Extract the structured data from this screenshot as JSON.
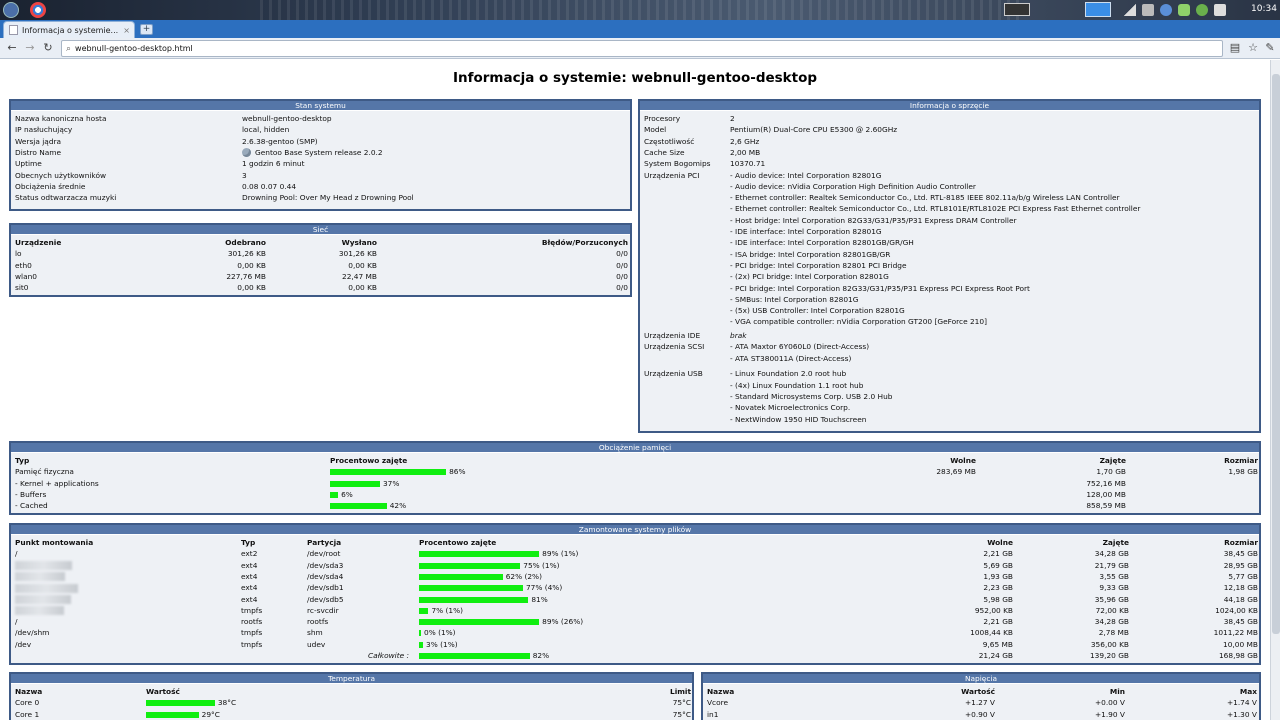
{
  "desktop": {
    "clock": "10:34"
  },
  "browser": {
    "tab_title": "Informacja o systemie...",
    "new_tab": "+",
    "url": "webnull-gentoo-desktop.html"
  },
  "page_title": "Informacja o systemie: webnull-gentoo-desktop",
  "system": {
    "title": "Stan systemu",
    "rows": [
      {
        "label": "Nazwa kanoniczna hosta",
        "value": "webnull-gentoo-desktop"
      },
      {
        "label": "IP nasłuchujący",
        "value": "local, hidden"
      },
      {
        "label": "Wersja jądra",
        "value": "2.6.38-gentoo (SMP)"
      },
      {
        "label": "Distro Name",
        "value": "Gentoo Base System release 2.0.2"
      },
      {
        "label": "Uptime",
        "value": "1 godzin 6 minut"
      },
      {
        "label": "Obecnych użytkowników",
        "value": "3"
      },
      {
        "label": "Obciążenia średnie",
        "value": "0.08 0.07 0.44"
      },
      {
        "label": "Status odtwarzacza muzyki",
        "value": "Drowning Pool: Over My Head z Drowning Pool"
      }
    ]
  },
  "network": {
    "title": "Sieć",
    "headers": [
      "Urządzenie",
      "Odebrano",
      "Wysłano",
      "Błędów/Porzuconych"
    ],
    "rows": [
      [
        "lo",
        "301,26 KB",
        "301,26 KB",
        "0/0"
      ],
      [
        "eth0",
        "0,00 KB",
        "0,00 KB",
        "0/0"
      ],
      [
        "wlan0",
        "227,76 MB",
        "22,47 MB",
        "0/0"
      ],
      [
        "sit0",
        "0,00 KB",
        "0,00 KB",
        "0/0"
      ]
    ]
  },
  "hardware": {
    "title": "Informacja o sprzęcie",
    "rows": [
      {
        "label": "Procesory",
        "value": "2"
      },
      {
        "label": "Model",
        "value": "Pentium(R) Dual-Core CPU E5300 @ 2.60GHz"
      },
      {
        "label": "Częstotliwość",
        "value": "2,6 GHz"
      },
      {
        "label": "Cache Size",
        "value": "2,00 MB"
      },
      {
        "label": "System Bogomips",
        "value": "10370.71"
      }
    ],
    "pci_label": "Urządzenia PCI",
    "pci": [
      "- Audio device: Intel Corporation 82801G",
      "- Audio device: nVidia Corporation High Definition Audio Controller",
      "- Ethernet controller: Realtek Semiconductor Co., Ltd. RTL-8185 IEEE 802.11a/b/g Wireless LAN Controller",
      "- Ethernet controller: Realtek Semiconductor Co., Ltd. RTL8101E/RTL8102E PCI Express Fast Ethernet controller",
      "- Host bridge: Intel Corporation 82G33/G31/P35/P31 Express DRAM Controller",
      "- IDE interface: Intel Corporation 82801G",
      "- IDE interface: Intel Corporation 82801GB/GR/GH",
      "- ISA bridge: Intel Corporation 82801GB/GR",
      "- PCI bridge: Intel Corporation 82801 PCI Bridge",
      "- (2x) PCI bridge: Intel Corporation 82801G",
      "- PCI bridge: Intel Corporation 82G33/G31/P35/P31 Express PCI Express Root Port",
      "- SMBus: Intel Corporation 82801G",
      "- (5x) USB Controller: Intel Corporation 82801G",
      "- VGA compatible controller: nVidia Corporation GT200 [GeForce 210]"
    ],
    "ide_label": "Urządzenia IDE",
    "ide_value": "brak",
    "scsi_label": "Urządzenia SCSI",
    "scsi": [
      "- ATA Maxtor 6Y060L0 (Direct-Access)",
      "- ATA ST380011A (Direct-Access)"
    ],
    "usb_label": "Urządzenia USB",
    "usb": [
      "- Linux Foundation 2.0 root hub",
      "- (4x) Linux Foundation 1.1 root hub",
      "- Standard Microsystems Corp. USB 2.0 Hub",
      "- Novatek Microelectronics Corp.",
      "- NextWindow 1950 HID Touchscreen"
    ]
  },
  "memory": {
    "title": "Obciążenie pamięci",
    "headers": [
      "Typ",
      "Procentowo zajęte",
      "Wolne",
      "Zajęte",
      "Rozmiar"
    ],
    "rows": [
      {
        "type": "Pamięć fizyczna",
        "pct": 86,
        "pct_text": "86%",
        "free": "283,69 MB",
        "used": "1,70 GB",
        "size": "1,98 GB"
      },
      {
        "type": "- Kernel + applications",
        "pct": 37,
        "pct_text": "37%",
        "free": "",
        "used": "752,16 MB",
        "size": ""
      },
      {
        "type": "- Buffers",
        "pct": 6,
        "pct_text": "6%",
        "free": "",
        "used": "128,00 MB",
        "size": ""
      },
      {
        "type": "- Cached",
        "pct": 42,
        "pct_text": "42%",
        "free": "",
        "used": "858,59 MB",
        "size": ""
      }
    ]
  },
  "filesystems": {
    "title": "Zamontowane systemy plików",
    "headers": [
      "Punkt montowania",
      "Typ",
      "Partycja",
      "Procentowo zajęte",
      "Wolne",
      "Zajęte",
      "Rozmiar"
    ],
    "rows": [
      {
        "mount": "/",
        "type": "ext2",
        "part": "/dev/root",
        "pct": 89,
        "pct_text": "89% (1%)",
        "free": "2,21 GB",
        "used": "34,28 GB",
        "size": "38,45 GB"
      },
      {
        "mount": "",
        "type": "ext4",
        "part": "/dev/sda3",
        "pct": 75,
        "pct_text": "75% (1%)",
        "free": "5,69 GB",
        "used": "21,79 GB",
        "size": "28,95 GB"
      },
      {
        "mount": "",
        "type": "ext4",
        "part": "/dev/sda4",
        "pct": 62,
        "pct_text": "62% (2%)",
        "free": "1,93 GB",
        "used": "3,55 GB",
        "size": "5,77 GB"
      },
      {
        "mount": "",
        "type": "ext4",
        "part": "/dev/sdb1",
        "pct": 77,
        "pct_text": "77% (4%)",
        "free": "2,23 GB",
        "used": "9,33 GB",
        "size": "12,18 GB"
      },
      {
        "mount": "",
        "type": "ext4",
        "part": "/dev/sdb5",
        "pct": 81,
        "pct_text": "81%",
        "free": "5,98 GB",
        "used": "35,96 GB",
        "size": "44,18 GB"
      },
      {
        "mount": "",
        "type": "tmpfs",
        "part": "rc-svcdir",
        "pct": 7,
        "pct_text": "7% (1%)",
        "free": "952,00 KB",
        "used": "72,00 KB",
        "size": "1024,00 KB"
      },
      {
        "mount": "/",
        "type": "rootfs",
        "part": "rootfs",
        "pct": 89,
        "pct_text": "89% (26%)",
        "free": "2,21 GB",
        "used": "34,28 GB",
        "size": "38,45 GB"
      },
      {
        "mount": "/dev/shm",
        "type": "tmpfs",
        "part": "shm",
        "pct": 0,
        "pct_text": "0% (1%)",
        "free": "1008,44 KB",
        "used": "2,78 MB",
        "size": "1011,22 MB"
      },
      {
        "mount": "/dev",
        "type": "tmpfs",
        "part": "udev",
        "pct": 3,
        "pct_text": "3% (1%)",
        "free": "9,65 MB",
        "used": "356,00 KB",
        "size": "10,00 MB"
      }
    ],
    "total": {
      "label": "Całkowite :",
      "pct": 82,
      "pct_text": "82%",
      "free": "21,24 GB",
      "used": "139,20 GB",
      "size": "168,98 GB"
    }
  },
  "temperature": {
    "title": "Temperatura",
    "headers": [
      "Nazwa",
      "Wartość",
      "Limit"
    ],
    "rows": [
      {
        "name": "Core 0",
        "pct": 51,
        "value": "38°C",
        "limit": "75°C"
      },
      {
        "name": "Core 1",
        "pct": 39,
        "value": "29°C",
        "limit": "75°C"
      }
    ]
  },
  "voltage": {
    "title": "Napięcia",
    "headers": [
      "Nazwa",
      "Wartość",
      "Min",
      "Max"
    ],
    "rows": [
      {
        "name": "Vcore",
        "value": "+1.27 V",
        "min": "+0.00 V",
        "max": "+1.74 V"
      },
      {
        "name": "in1",
        "value": "+0.90 V",
        "min": "+1.90 V",
        "max": "+1.30 V"
      }
    ]
  }
}
